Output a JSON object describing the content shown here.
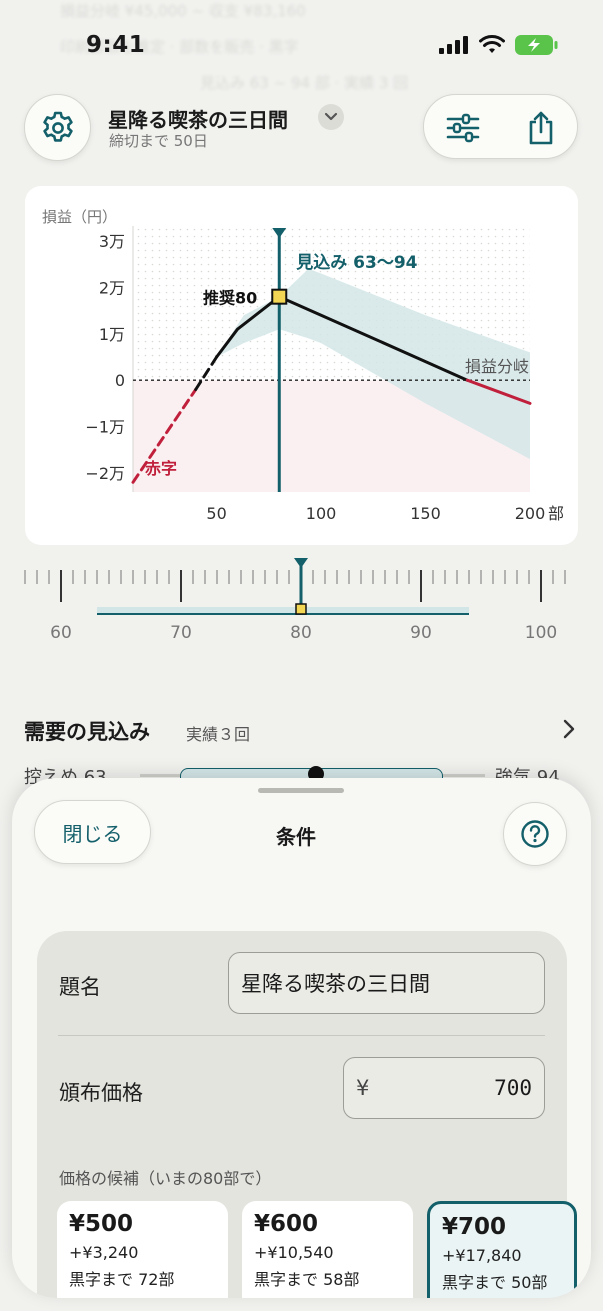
{
  "status": {
    "time": "9:41"
  },
  "background_text": {
    "line1": "損益分岐 ¥45,000 ~ 収支 ¥83,160",
    "line2": "印刷部数を推定 · 部数を販売 · 黒字",
    "line3": "見込み 63 ~ 94 部 · 実績 3 回"
  },
  "header": {
    "title": "星降る喫茶の三日間",
    "subtitle": "締切まで 50日",
    "icons": {
      "settings": "gear-icon",
      "filters": "sliders-icon",
      "share": "share-icon",
      "title_menu": "chevron-down-icon"
    }
  },
  "chart": {
    "y_axis_title": "損益（円）",
    "y_ticks": [
      "3万",
      "2万",
      "1万",
      "0",
      "−1万",
      "−2万"
    ],
    "x_ticks": [
      "50",
      "100",
      "150",
      "200"
    ],
    "x_unit": "部",
    "forecast_label": "見込み 63～94",
    "recommend_label": "推奨80",
    "breakeven_label": "損益分岐",
    "loss_label": "赤字"
  },
  "chart_data": {
    "type": "line",
    "title": "",
    "xlabel": "部",
    "ylabel": "損益（円）",
    "xlim": [
      10,
      200
    ],
    "ylim": [
      -25000,
      30000
    ],
    "series": [
      {
        "name": "",
        "x": [
          10,
          40,
          50,
          60,
          80,
          100,
          150,
          170,
          200
        ],
        "y": [
          -22000,
          -2000,
          5000,
          11000,
          18000,
          14000,
          4000,
          0,
          -5000
        ]
      }
    ],
    "forecast_band": {
      "x": [
        50,
        63,
        80,
        94,
        100,
        150,
        200
      ],
      "upper": [
        5000,
        14000,
        18000,
        24000,
        23000,
        14000,
        6000
      ],
      "lower": [
        5000,
        8000,
        11000,
        9000,
        8000,
        -5000,
        -17000
      ]
    },
    "recommended": {
      "x": 80,
      "y": 18000
    },
    "forecast_range": [
      63,
      94
    ],
    "breakeven_x": 170,
    "grid": false
  },
  "ruler": {
    "labels": [
      "60",
      "70",
      "80",
      "90",
      "100"
    ],
    "selected": 80,
    "range": [
      63,
      94
    ]
  },
  "demand": {
    "title": "需要の見込み",
    "sub": "実績３回",
    "low_label": "控えめ",
    "low_value": "63",
    "high_label": "強気",
    "high_value": "94",
    "icon": "chevron-right-icon"
  },
  "sheet": {
    "close_label": "閉じる",
    "title": "条件",
    "help_icon": "question-icon",
    "form": {
      "title_label": "題名",
      "title_value": "星降る喫茶の三日間",
      "price_label": "頒布価格",
      "price_currency": "¥",
      "price_value": "700",
      "candidates_label": "価格の候補（いまの80部で）",
      "candidates": [
        {
          "price": "¥500",
          "profit": "+¥3,240",
          "breakeven": "黒字まで 72部",
          "selected": false
        },
        {
          "price": "¥600",
          "profit": "+¥10,540",
          "breakeven": "黒字まで 58部",
          "selected": false
        },
        {
          "price": "¥700",
          "profit": "+¥17,840",
          "breakeven": "黒字まで 50部",
          "selected": true
        }
      ]
    }
  },
  "colors": {
    "accent": "#135f6a",
    "loss": "#c0203c",
    "band": "#d3e6e7",
    "marker": "#f3d653"
  }
}
